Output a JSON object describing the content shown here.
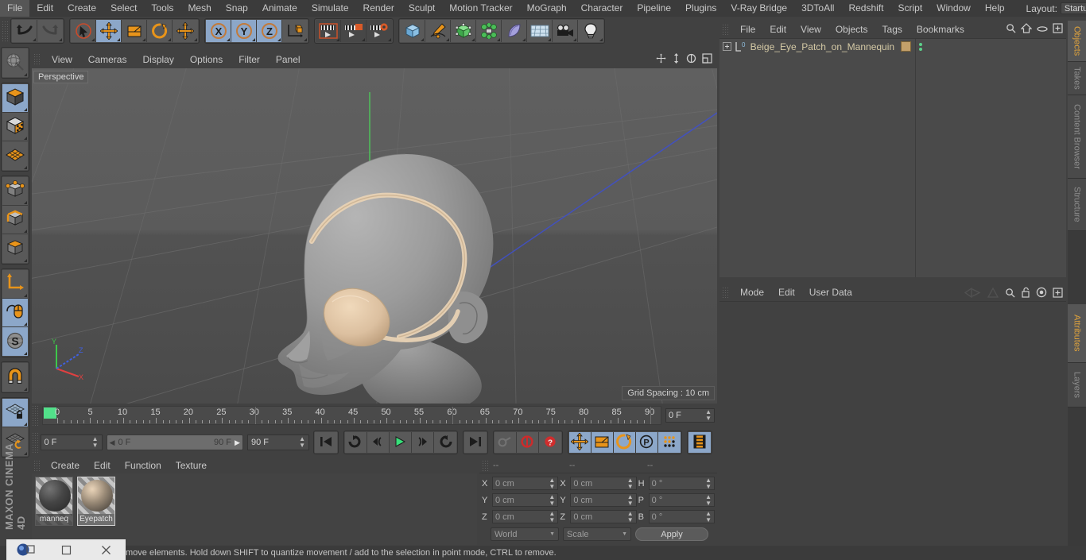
{
  "menubar": {
    "items": [
      "File",
      "Edit",
      "Create",
      "Select",
      "Tools",
      "Mesh",
      "Snap",
      "Animate",
      "Simulate",
      "Render",
      "Sculpt",
      "Motion Tracker",
      "MoGraph",
      "Character",
      "Pipeline",
      "Plugins",
      "V-Ray Bridge",
      "3DToAll",
      "Redshift",
      "Script",
      "Window",
      "Help"
    ],
    "layout_label": "Layout:",
    "layout_value": "Startup",
    "search_icon": "search-icon"
  },
  "toolbar": {
    "groups": [
      {
        "name": "undo-redo",
        "buttons": [
          {
            "name": "undo-button",
            "icon": "undo-arrow-icon",
            "state": "normal"
          },
          {
            "name": "redo-button",
            "icon": "redo-arrow-icon",
            "state": "disabled"
          }
        ]
      },
      {
        "name": "transform-tools",
        "buttons": [
          {
            "name": "select-tool-button",
            "icon": "cursor-select-icon",
            "state": "normal"
          },
          {
            "name": "move-tool-button",
            "icon": "move-arrows-icon",
            "state": "active"
          },
          {
            "name": "scale-tool-button",
            "icon": "scale-box-icon",
            "state": "normal"
          },
          {
            "name": "rotate-tool-button",
            "icon": "rotate-circle-icon",
            "state": "normal"
          },
          {
            "name": "move-secondary-button",
            "icon": "move-arrows-icon",
            "state": "normal"
          }
        ]
      },
      {
        "name": "axis-locks",
        "buttons": [
          {
            "name": "lock-x-button",
            "icon": "axis-x-icon",
            "state": "active"
          },
          {
            "name": "lock-y-button",
            "icon": "axis-y-icon",
            "state": "active"
          },
          {
            "name": "lock-z-button",
            "icon": "axis-z-icon",
            "state": "active"
          },
          {
            "name": "world-coordinate-button",
            "icon": "world-axis-cube-icon",
            "state": "normal"
          }
        ]
      },
      {
        "name": "render-tools",
        "buttons": [
          {
            "name": "render-view-button",
            "icon": "clapper-view-icon",
            "state": "normal"
          },
          {
            "name": "render-region-button",
            "icon": "clapper-region-icon",
            "state": "normal"
          },
          {
            "name": "render-settings-button",
            "icon": "clapper-gear-icon",
            "state": "normal"
          }
        ]
      },
      {
        "name": "create-objects",
        "buttons": [
          {
            "name": "add-cube-button",
            "icon": "blue-cube-icon",
            "state": "normal"
          },
          {
            "name": "add-spline-button",
            "icon": "pen-spline-icon",
            "state": "normal"
          },
          {
            "name": "add-generator-button",
            "icon": "green-cube-icon",
            "state": "normal"
          },
          {
            "name": "add-deformer-button",
            "icon": "green-cluster-icon",
            "state": "normal"
          },
          {
            "name": "add-bend-button",
            "icon": "purple-bend-icon",
            "state": "normal"
          },
          {
            "name": "add-floor-button",
            "icon": "grid-floor-icon",
            "state": "normal"
          },
          {
            "name": "add-camera-button",
            "icon": "camera-icon",
            "state": "normal"
          },
          {
            "name": "add-light-button",
            "icon": "lightbulb-icon",
            "state": "normal"
          }
        ]
      }
    ]
  },
  "left_toolbar": {
    "groups": [
      {
        "name": "live-selection",
        "buttons": [
          {
            "name": "live-selection-button",
            "icon": "globe-selection-icon",
            "state": "normal"
          }
        ]
      },
      {
        "name": "editor-modes",
        "buttons": [
          {
            "name": "model-mode-button",
            "icon": "model-cube-icon",
            "state": "active"
          },
          {
            "name": "texture-mode-button",
            "icon": "texture-cube-icon",
            "state": "normal"
          },
          {
            "name": "uv-mode-button",
            "icon": "uv-mesh-icon",
            "state": "normal"
          }
        ]
      },
      {
        "name": "component-modes",
        "buttons": [
          {
            "name": "points-mode-button",
            "icon": "point-cube-icon",
            "state": "normal"
          },
          {
            "name": "edges-mode-button",
            "icon": "edge-cube-icon",
            "state": "normal"
          },
          {
            "name": "polygons-mode-button",
            "icon": "polygon-cube-icon",
            "state": "normal"
          }
        ]
      },
      {
        "name": "axis-tools",
        "buttons": [
          {
            "name": "enable-axis-button",
            "icon": "axis-arrow-icon",
            "state": "normal"
          },
          {
            "name": "viewport-solo-button",
            "icon": "mouse-axis-icon",
            "state": "active"
          },
          {
            "name": "soft-selection-button",
            "icon": "soft-selection-s-icon",
            "state": "active"
          }
        ]
      },
      {
        "name": "snap-tools",
        "buttons": [
          {
            "name": "snap-magnet-button",
            "icon": "magnet-icon",
            "state": "normal"
          }
        ]
      },
      {
        "name": "workplane-tools",
        "buttons": [
          {
            "name": "lock-workplane-button",
            "icon": "workplane-lock-icon",
            "state": "active"
          },
          {
            "name": "workplane-rotate-button",
            "icon": "workplane-rotate-icon",
            "state": "normal"
          }
        ]
      }
    ],
    "brand": "MAXON CINEMA 4D"
  },
  "viewport": {
    "menus": [
      "View",
      "Cameras",
      "Display",
      "Options",
      "Filter",
      "Panel"
    ],
    "control_icons": [
      "pan-viewport-icon",
      "dolly-viewport-icon",
      "rotate-viewport-icon",
      "maximize-viewport-icon"
    ],
    "perspective_label": "Perspective",
    "grid_spacing_label": "Grid Spacing : 10 cm",
    "axis_labels": {
      "x": "X",
      "y": "Y",
      "z": "Z"
    },
    "axis_colors": {
      "x": "#e04040",
      "y": "#3ec84a",
      "z": "#4060e0"
    },
    "scene_description": "Grey mannequin head wearing a beige eye patch"
  },
  "timeline": {
    "ticks": [
      {
        "label": "0",
        "value": 0
      },
      {
        "label": "5",
        "value": 5
      },
      {
        "label": "10",
        "value": 10
      },
      {
        "label": "15",
        "value": 15
      },
      {
        "label": "20",
        "value": 20
      },
      {
        "label": "25",
        "value": 25
      },
      {
        "label": "30",
        "value": 30
      },
      {
        "label": "35",
        "value": 35
      },
      {
        "label": "40",
        "value": 40
      },
      {
        "label": "45",
        "value": 45
      },
      {
        "label": "50",
        "value": 50
      },
      {
        "label": "55",
        "value": 55
      },
      {
        "label": "60",
        "value": 60
      },
      {
        "label": "65",
        "value": 65
      },
      {
        "label": "70",
        "value": 70
      },
      {
        "label": "75",
        "value": 75
      },
      {
        "label": "80",
        "value": 80
      },
      {
        "label": "85",
        "value": 85
      },
      {
        "label": "90",
        "value": 90
      }
    ],
    "current_frame_field": "0 F",
    "playhead_frame": 0
  },
  "playbar": {
    "current_frame": "0 F",
    "range_start": "0 F",
    "range_end": "90 F",
    "end_frame": "90 F",
    "buttons": [
      {
        "name": "go-to-start-button",
        "icon": "skip-start-icon",
        "state": "normal"
      },
      {
        "name": "previous-keyframe-button",
        "icon": "prev-key-icon",
        "state": "normal"
      },
      {
        "name": "step-back-button",
        "icon": "step-back-icon",
        "state": "normal"
      },
      {
        "name": "play-button",
        "icon": "play-icon",
        "state": "normal"
      },
      {
        "name": "step-forward-button",
        "icon": "step-forward-icon",
        "state": "normal"
      },
      {
        "name": "next-keyframe-button",
        "icon": "next-key-icon",
        "state": "normal"
      },
      {
        "name": "go-to-end-button",
        "icon": "skip-end-icon",
        "state": "normal"
      },
      {
        "name": "autokey-button",
        "icon": "key-icon",
        "state": "disabled"
      },
      {
        "name": "record-active-objects-button",
        "icon": "record-circle-icon",
        "state": "normal"
      },
      {
        "name": "auto-keying-button",
        "icon": "question-circle-icon",
        "state": "normal"
      },
      {
        "name": "key-position-button",
        "icon": "move-arrows-icon",
        "state": "active"
      },
      {
        "name": "key-scale-button",
        "icon": "scale-box-icon",
        "state": "active"
      },
      {
        "name": "key-rotation-button",
        "icon": "rotate-circle-icon",
        "state": "active"
      },
      {
        "name": "key-parameter-button",
        "icon": "parameter-p-icon",
        "state": "active"
      },
      {
        "name": "key-point-level-button",
        "icon": "point-level-dots-icon",
        "state": "active"
      },
      {
        "name": "timeline-toggle-button",
        "icon": "filmstrip-icon",
        "state": "active"
      }
    ]
  },
  "material_manager": {
    "menus": [
      "Create",
      "Edit",
      "Function",
      "Texture"
    ],
    "materials": [
      {
        "name": "manneq",
        "color": "#5e5e5e",
        "selected": false
      },
      {
        "name": "Eyepatch",
        "color": "#e6cdae",
        "selected": true
      }
    ]
  },
  "coordinates": {
    "header_placeholders": [
      "--",
      "--",
      "--"
    ],
    "position": {
      "label_x": "X",
      "label_y": "Y",
      "label_z": "Z",
      "x": "0 cm",
      "y": "0 cm",
      "z": "0 cm"
    },
    "size": {
      "label_x": "X",
      "label_y": "Y",
      "label_z": "Z",
      "x": "0 cm",
      "y": "0 cm",
      "z": "0 cm"
    },
    "rotation": {
      "label_h": "H",
      "label_p": "P",
      "label_b": "B",
      "h": "0 °",
      "p": "0 °",
      "b": "0 °"
    },
    "coordinate_system": "World",
    "transform_mode": "Scale",
    "apply_label": "Apply"
  },
  "object_manager": {
    "menus": [
      "File",
      "Edit",
      "View",
      "Objects",
      "Tags",
      "Bookmarks"
    ],
    "header_icons": [
      "search-icon",
      "home-icon",
      "ellipse-icon",
      "expand-icon"
    ],
    "objects": [
      {
        "name": "Beige_Eye_Patch_on_Mannequin",
        "layer_badge": "0",
        "tag_color": "#c3a06a"
      }
    ]
  },
  "attribute_manager": {
    "menus": [
      "Mode",
      "Edit",
      "User Data"
    ],
    "header_icons": [
      "animate-left-icon",
      "animate-right-icon",
      "search-icon",
      "unlock-icon",
      "target-icon",
      "expand-icon"
    ]
  },
  "right_tabs": [
    {
      "label": "Objects",
      "active": true
    },
    {
      "label": "Takes",
      "active": false
    },
    {
      "label": "Content Browser",
      "active": false
    },
    {
      "label": "Structure",
      "active": false
    },
    {
      "label": "Attributes",
      "active": true
    },
    {
      "label": "Layers",
      "active": false
    }
  ],
  "statusbar": {
    "message": "move elements. Hold down SHIFT to quantize movement / add to the selection in point mode, CTRL to remove."
  },
  "taskbar": {
    "items": [
      "app-icon",
      "restore-icon",
      "close-icon"
    ]
  },
  "colors": {
    "accent_orange": "#e0a33c",
    "active_blue": "#8ca7c9",
    "panel_bg": "#414141",
    "field_bg": "#4a4a4a",
    "green_playhead": "#52e08a"
  }
}
